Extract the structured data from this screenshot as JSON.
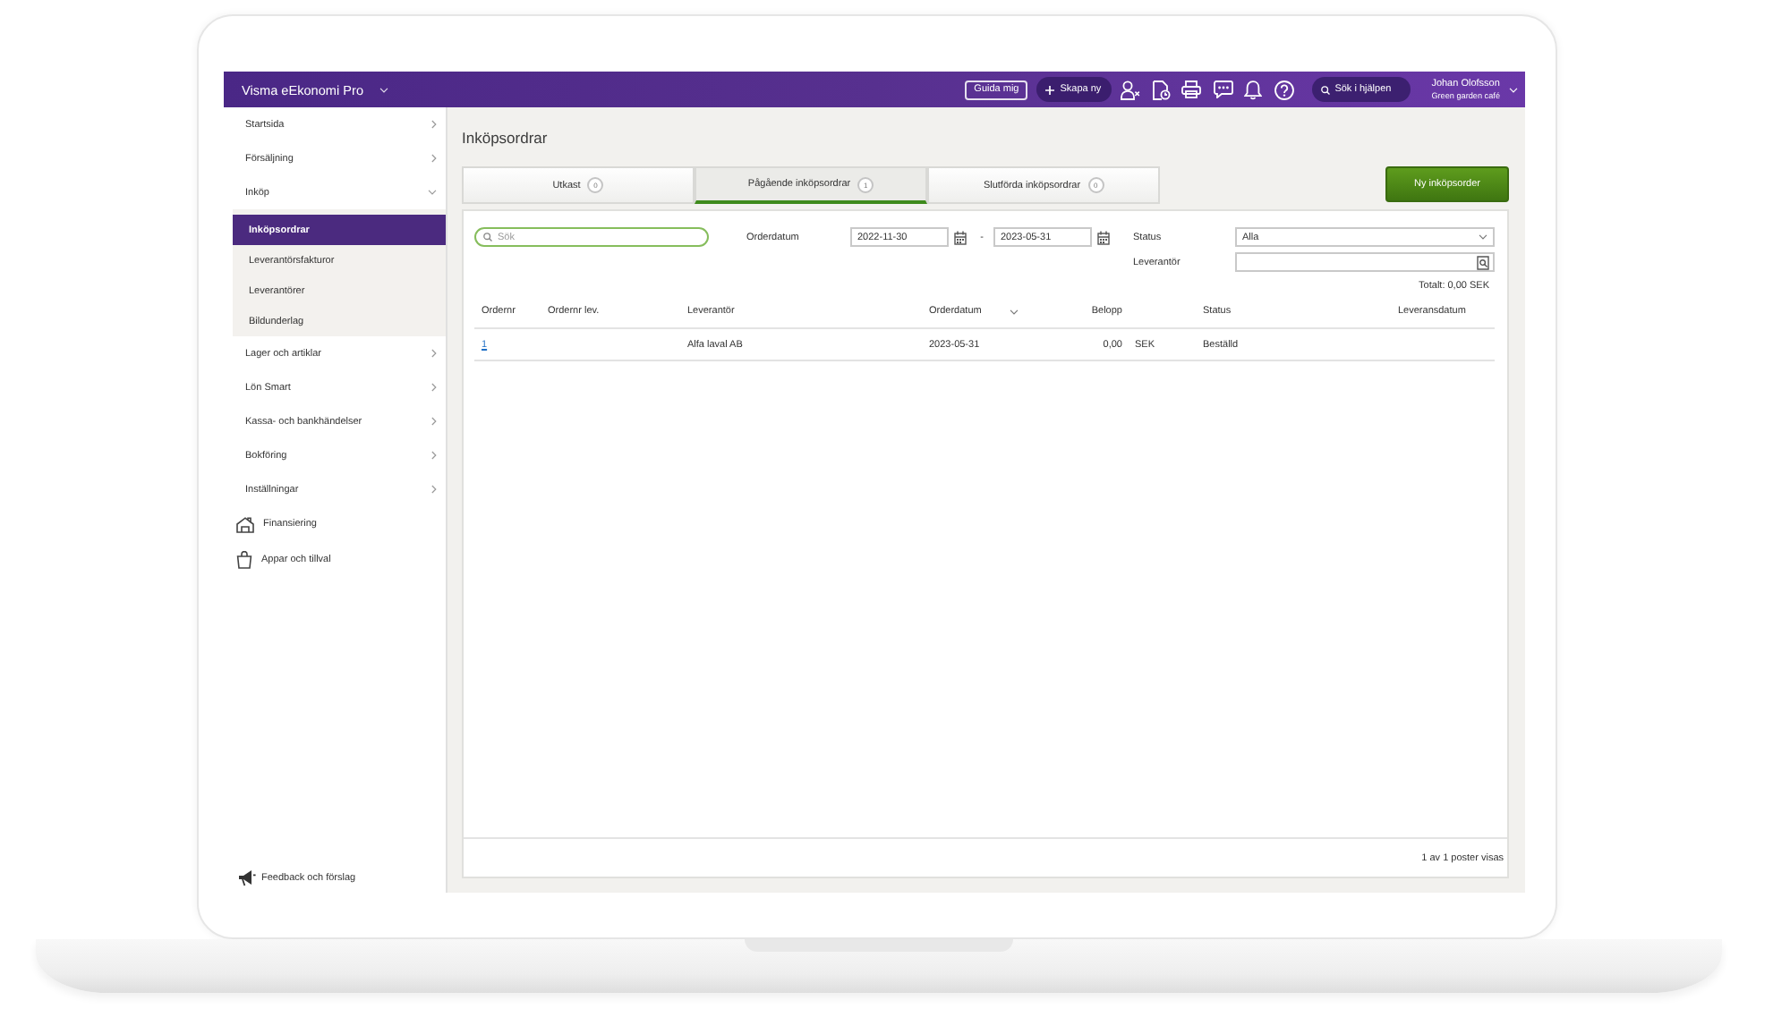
{
  "app_bar": {
    "title": "Visma eEkonomi Pro",
    "guide_button": "Guida mig",
    "create_button": "Skapa ny",
    "help_search_button": "Sök i hjälpen",
    "user": {
      "name": "Johan Olofsson",
      "company": "Green garden café"
    }
  },
  "sidebar": {
    "items": [
      {
        "label": "Startsida",
        "selected": false,
        "expanded": false
      },
      {
        "label": "Försäljning",
        "selected": false,
        "expanded": false
      },
      {
        "label": "Inköp",
        "selected": false,
        "expanded": true,
        "children": [
          {
            "label": "Inköpsordrar",
            "selected": true
          },
          {
            "label": "Leverantörsfakturor",
            "selected": false
          },
          {
            "label": "Leverantörer",
            "selected": false
          },
          {
            "label": "Bildunderlag",
            "selected": false
          }
        ]
      },
      {
        "label": "Lager och artiklar",
        "selected": false,
        "expanded": false
      },
      {
        "label": "Lön Smart",
        "selected": false,
        "expanded": false
      },
      {
        "label": "Kassa- och bankhändelser",
        "selected": false,
        "expanded": false
      },
      {
        "label": "Bokföring",
        "selected": false,
        "expanded": false
      },
      {
        "label": "Inställningar",
        "selected": false,
        "expanded": false
      }
    ],
    "shortcuts": [
      {
        "label": "Finansiering"
      },
      {
        "label": "Appar och tillval"
      }
    ],
    "feedback_link": "Feedback och förslag"
  },
  "page": {
    "title": "Inköpsordrar",
    "tabs": [
      {
        "label": "Utkast",
        "count": "0",
        "selected": false
      },
      {
        "label": "Pågående inköpsordrar",
        "count": "1",
        "selected": true
      },
      {
        "label": "Slutförda inköpsordrar",
        "count": "0",
        "selected": false
      }
    ],
    "new_order_button": "Ny inköpsorder",
    "filters": {
      "search": {
        "placeholder": "Sök"
      },
      "order_date": {
        "label": "Orderdatum",
        "from": "2022-11-30",
        "separator": "-",
        "to": "2023-05-31"
      },
      "status": {
        "label": "Status",
        "value": "Alla"
      },
      "supplier": {
        "label": "Leverantör"
      }
    },
    "total": "Totalt: 0,00 SEK",
    "table": {
      "columns": [
        {
          "label": "Ordernr",
          "sorted": false
        },
        {
          "label": "Ordernr lev.",
          "sorted": false
        },
        {
          "label": "Leverantör",
          "sorted": false
        },
        {
          "label": "Orderdatum",
          "sorted": true
        },
        {
          "label": "Belopp",
          "sorted": false
        },
        {
          "label": "Status",
          "sorted": false
        },
        {
          "label": "Leveransdatum",
          "sorted": false
        }
      ],
      "rows": [
        {
          "order_number": "1",
          "supplier": "Alfa laval AB",
          "order_date": "2023-05-31",
          "amount": "0,00",
          "currency": "SEK",
          "status": "Beställd"
        }
      ]
    },
    "pagination": "1 av 1 poster visas"
  }
}
